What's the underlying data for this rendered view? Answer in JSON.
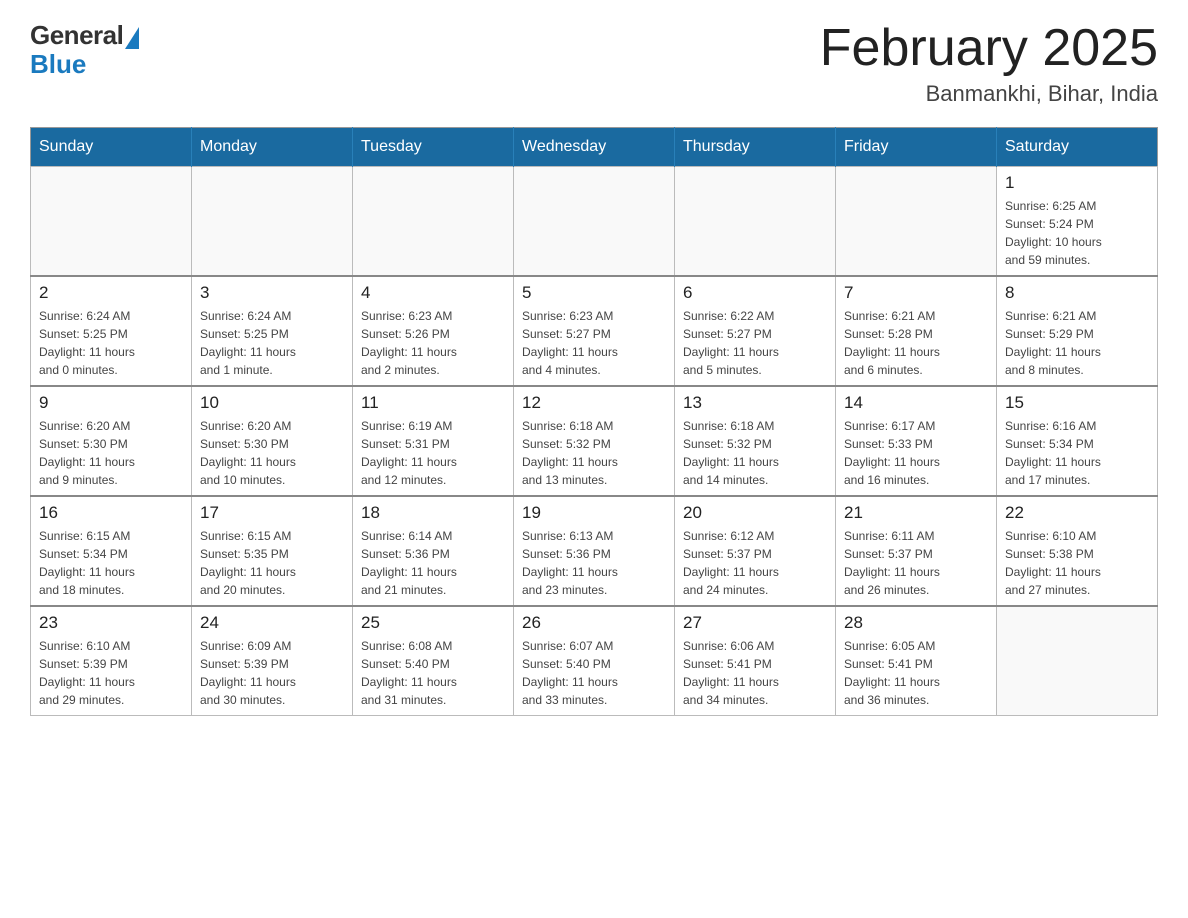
{
  "logo": {
    "general": "General",
    "blue": "Blue"
  },
  "title": "February 2025",
  "subtitle": "Banmankhi, Bihar, India",
  "weekdays": [
    "Sunday",
    "Monday",
    "Tuesday",
    "Wednesday",
    "Thursday",
    "Friday",
    "Saturday"
  ],
  "weeks": [
    [
      {
        "day": "",
        "info": ""
      },
      {
        "day": "",
        "info": ""
      },
      {
        "day": "",
        "info": ""
      },
      {
        "day": "",
        "info": ""
      },
      {
        "day": "",
        "info": ""
      },
      {
        "day": "",
        "info": ""
      },
      {
        "day": "1",
        "info": "Sunrise: 6:25 AM\nSunset: 5:24 PM\nDaylight: 10 hours\nand 59 minutes."
      }
    ],
    [
      {
        "day": "2",
        "info": "Sunrise: 6:24 AM\nSunset: 5:25 PM\nDaylight: 11 hours\nand 0 minutes."
      },
      {
        "day": "3",
        "info": "Sunrise: 6:24 AM\nSunset: 5:25 PM\nDaylight: 11 hours\nand 1 minute."
      },
      {
        "day": "4",
        "info": "Sunrise: 6:23 AM\nSunset: 5:26 PM\nDaylight: 11 hours\nand 2 minutes."
      },
      {
        "day": "5",
        "info": "Sunrise: 6:23 AM\nSunset: 5:27 PM\nDaylight: 11 hours\nand 4 minutes."
      },
      {
        "day": "6",
        "info": "Sunrise: 6:22 AM\nSunset: 5:27 PM\nDaylight: 11 hours\nand 5 minutes."
      },
      {
        "day": "7",
        "info": "Sunrise: 6:21 AM\nSunset: 5:28 PM\nDaylight: 11 hours\nand 6 minutes."
      },
      {
        "day": "8",
        "info": "Sunrise: 6:21 AM\nSunset: 5:29 PM\nDaylight: 11 hours\nand 8 minutes."
      }
    ],
    [
      {
        "day": "9",
        "info": "Sunrise: 6:20 AM\nSunset: 5:30 PM\nDaylight: 11 hours\nand 9 minutes."
      },
      {
        "day": "10",
        "info": "Sunrise: 6:20 AM\nSunset: 5:30 PM\nDaylight: 11 hours\nand 10 minutes."
      },
      {
        "day": "11",
        "info": "Sunrise: 6:19 AM\nSunset: 5:31 PM\nDaylight: 11 hours\nand 12 minutes."
      },
      {
        "day": "12",
        "info": "Sunrise: 6:18 AM\nSunset: 5:32 PM\nDaylight: 11 hours\nand 13 minutes."
      },
      {
        "day": "13",
        "info": "Sunrise: 6:18 AM\nSunset: 5:32 PM\nDaylight: 11 hours\nand 14 minutes."
      },
      {
        "day": "14",
        "info": "Sunrise: 6:17 AM\nSunset: 5:33 PM\nDaylight: 11 hours\nand 16 minutes."
      },
      {
        "day": "15",
        "info": "Sunrise: 6:16 AM\nSunset: 5:34 PM\nDaylight: 11 hours\nand 17 minutes."
      }
    ],
    [
      {
        "day": "16",
        "info": "Sunrise: 6:15 AM\nSunset: 5:34 PM\nDaylight: 11 hours\nand 18 minutes."
      },
      {
        "day": "17",
        "info": "Sunrise: 6:15 AM\nSunset: 5:35 PM\nDaylight: 11 hours\nand 20 minutes."
      },
      {
        "day": "18",
        "info": "Sunrise: 6:14 AM\nSunset: 5:36 PM\nDaylight: 11 hours\nand 21 minutes."
      },
      {
        "day": "19",
        "info": "Sunrise: 6:13 AM\nSunset: 5:36 PM\nDaylight: 11 hours\nand 23 minutes."
      },
      {
        "day": "20",
        "info": "Sunrise: 6:12 AM\nSunset: 5:37 PM\nDaylight: 11 hours\nand 24 minutes."
      },
      {
        "day": "21",
        "info": "Sunrise: 6:11 AM\nSunset: 5:37 PM\nDaylight: 11 hours\nand 26 minutes."
      },
      {
        "day": "22",
        "info": "Sunrise: 6:10 AM\nSunset: 5:38 PM\nDaylight: 11 hours\nand 27 minutes."
      }
    ],
    [
      {
        "day": "23",
        "info": "Sunrise: 6:10 AM\nSunset: 5:39 PM\nDaylight: 11 hours\nand 29 minutes."
      },
      {
        "day": "24",
        "info": "Sunrise: 6:09 AM\nSunset: 5:39 PM\nDaylight: 11 hours\nand 30 minutes."
      },
      {
        "day": "25",
        "info": "Sunrise: 6:08 AM\nSunset: 5:40 PM\nDaylight: 11 hours\nand 31 minutes."
      },
      {
        "day": "26",
        "info": "Sunrise: 6:07 AM\nSunset: 5:40 PM\nDaylight: 11 hours\nand 33 minutes."
      },
      {
        "day": "27",
        "info": "Sunrise: 6:06 AM\nSunset: 5:41 PM\nDaylight: 11 hours\nand 34 minutes."
      },
      {
        "day": "28",
        "info": "Sunrise: 6:05 AM\nSunset: 5:41 PM\nDaylight: 11 hours\nand 36 minutes."
      },
      {
        "day": "",
        "info": ""
      }
    ]
  ]
}
